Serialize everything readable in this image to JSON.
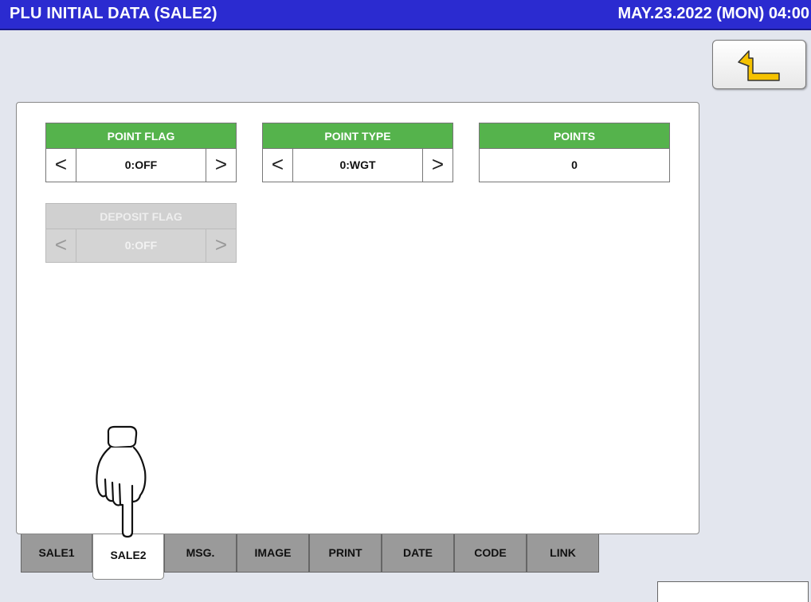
{
  "header": {
    "title": "PLU INITIAL DATA (SALE2)",
    "datetime": "MAY.23.2022 (MON)  04:00"
  },
  "back_button": {
    "icon": "return-arrow-icon",
    "icon_color": "#f5c200"
  },
  "fields": {
    "point_flag": {
      "label": "POINT FLAG",
      "value": "0:OFF",
      "prev": "<",
      "next": ">"
    },
    "point_type": {
      "label": "POINT TYPE",
      "value": "0:WGT",
      "prev": "<",
      "next": ">"
    },
    "points": {
      "label": "POINTS",
      "value": "0"
    },
    "deposit_flag": {
      "label": "DEPOSIT FLAG",
      "value": "0:OFF",
      "prev": "<",
      "next": ">",
      "disabled": true
    }
  },
  "tabs": [
    {
      "label": "SALE1"
    },
    {
      "label": "SALE2",
      "active": true
    },
    {
      "label": "MSG."
    },
    {
      "label": "IMAGE"
    },
    {
      "label": "PRINT"
    },
    {
      "label": "DATE"
    },
    {
      "label": "CODE"
    },
    {
      "label": "LINK"
    }
  ],
  "colors": {
    "title_bar": "#2b2bd0",
    "field_header": "#55b34c",
    "tab_inactive": "#9a9a9a",
    "background": "#e3e6ee"
  },
  "overlay": {
    "icon": "pointing-hand-icon"
  }
}
